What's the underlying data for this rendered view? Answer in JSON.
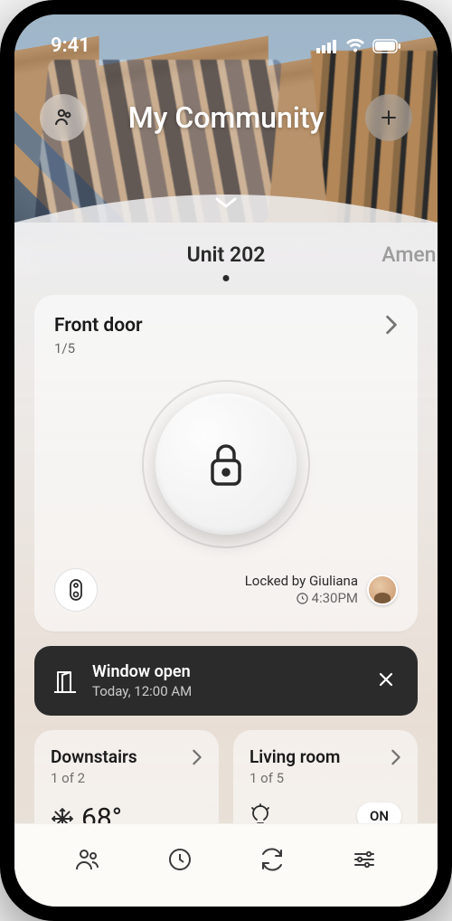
{
  "status": {
    "time": "9:41"
  },
  "header": {
    "title": "My Community"
  },
  "tabs": {
    "primary": "Unit 202",
    "secondary": "Amenit"
  },
  "lock_card": {
    "title": "Front door",
    "counter": "1/5",
    "locked_by_prefix": "Locked by",
    "locked_by_name": "Giuliana",
    "locked_time": "4:30PM"
  },
  "alert": {
    "title": "Window open",
    "sub": "Today, 12:00 AM"
  },
  "cards": {
    "downstairs": {
      "title": "Downstairs",
      "sub": "1 of 2",
      "temp": "68°"
    },
    "living": {
      "title": "Living room",
      "sub": "1 of 5",
      "state": "ON"
    }
  }
}
